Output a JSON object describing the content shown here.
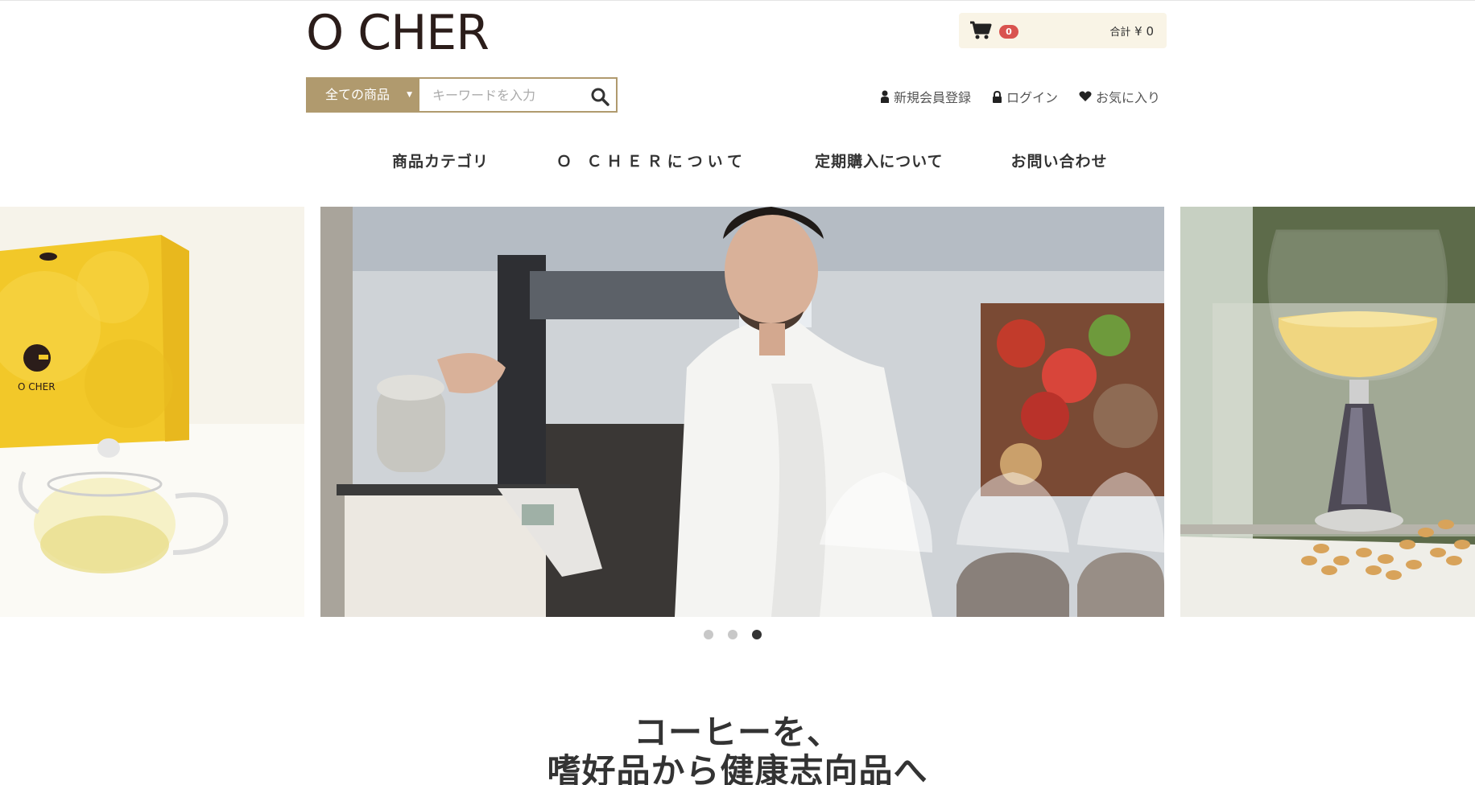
{
  "header": {
    "logo": "O CHER",
    "cart": {
      "count": "0",
      "total_label": "合計",
      "total_value": "¥ 0"
    },
    "search": {
      "category": "全ての商品",
      "placeholder": "キーワードを入力"
    },
    "user_nav": [
      {
        "label": "新規会員登録",
        "icon": "person-icon"
      },
      {
        "label": "ログイン",
        "icon": "lock-icon"
      },
      {
        "label": "お気に入り",
        "icon": "heart-icon"
      }
    ]
  },
  "main_nav": [
    {
      "label": "商品カテゴリ"
    },
    {
      "label": "Ｏ ＣＨＥＲについて"
    },
    {
      "label": "定期購入について"
    },
    {
      "label": "お問い合わせ"
    }
  ],
  "slider": {
    "left_box_label": "O CHER",
    "active_index": 3,
    "dots": 3
  },
  "hero": {
    "line1": "コーヒーを、",
    "line2": "嗜好品から健康志向品へ"
  },
  "colors": {
    "accent": "#b09a6e",
    "cart_bg": "#f9f4e6",
    "badge": "#d9534f",
    "logo": "#2b1d1a"
  }
}
